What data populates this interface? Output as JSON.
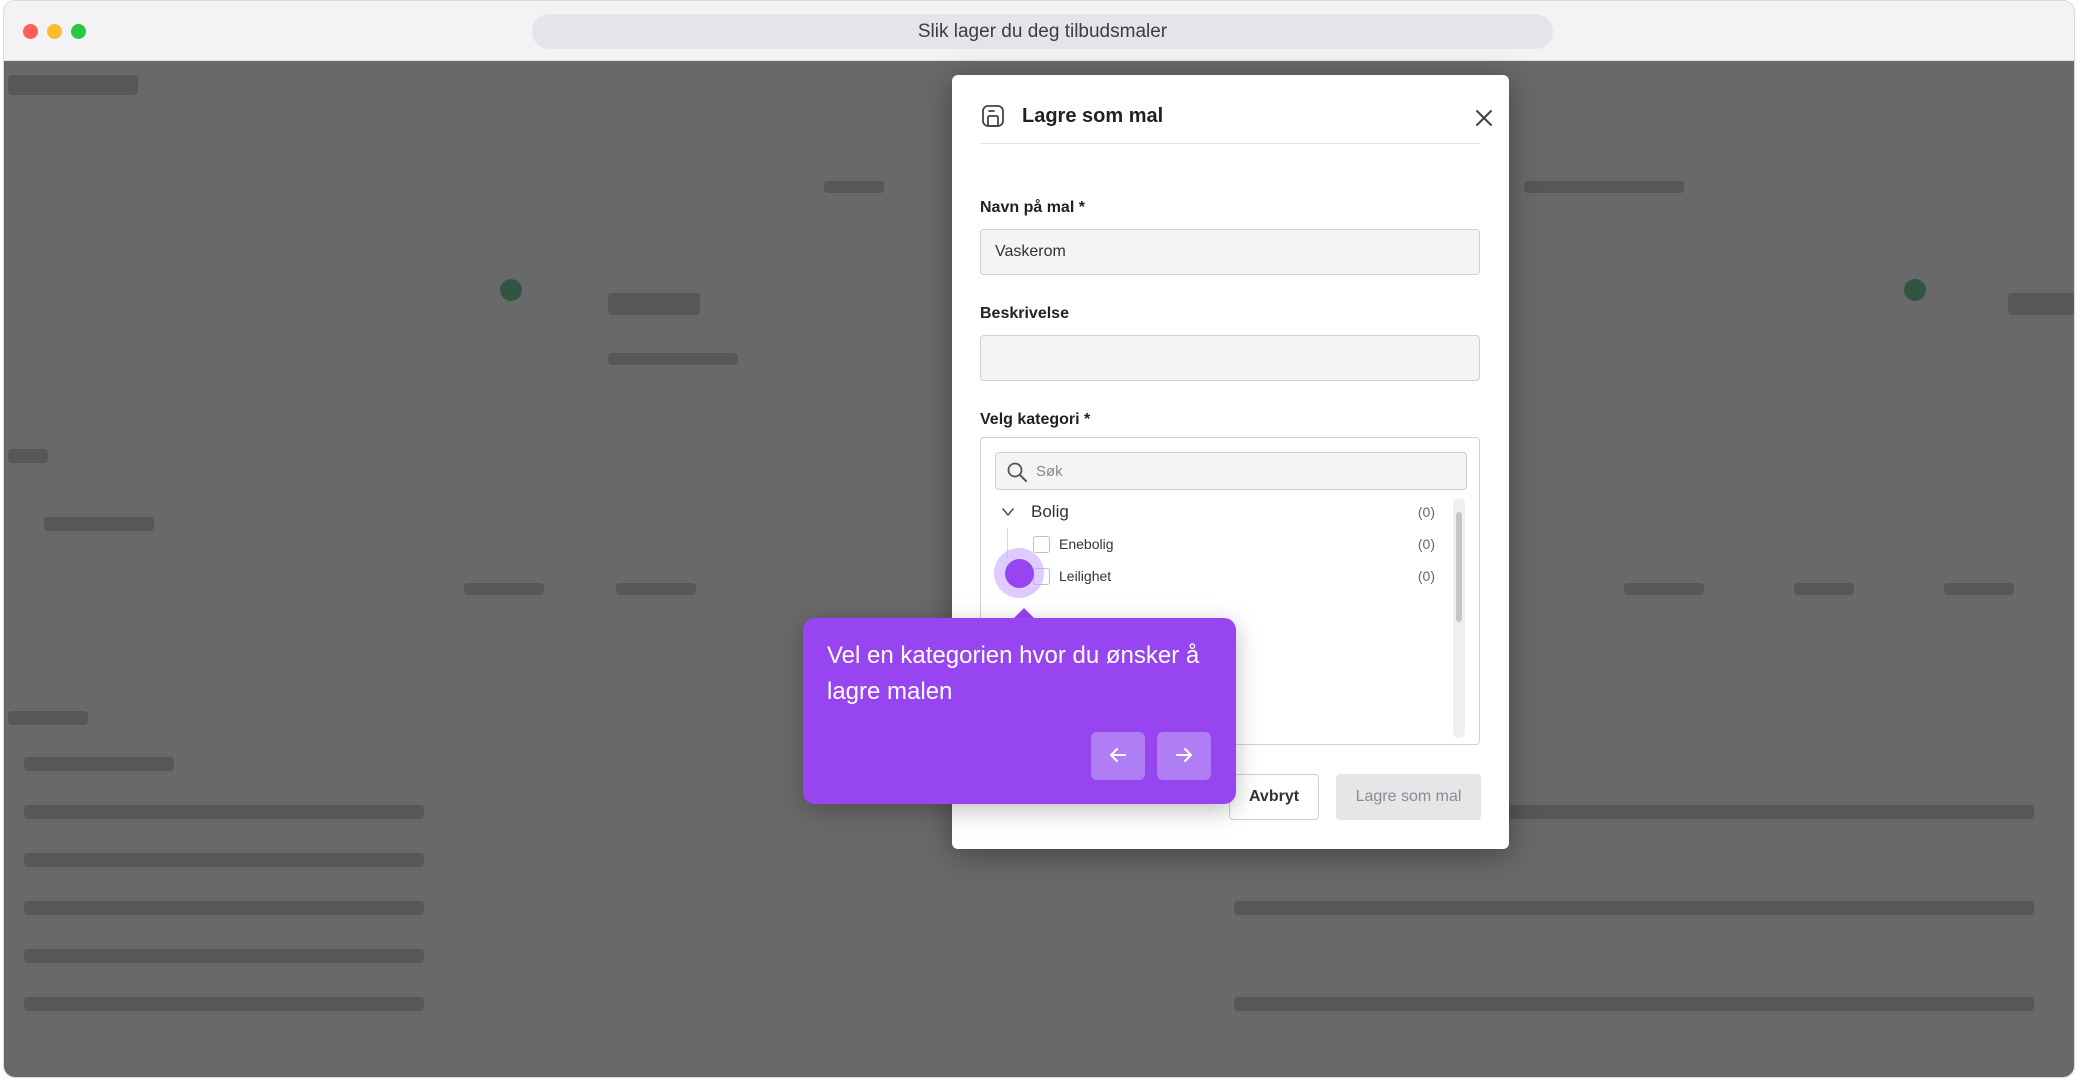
{
  "browser": {
    "address_text": "Slik lager du deg tilbudsmaler"
  },
  "modal": {
    "title": "Lagre som mal",
    "name_label": "Navn på mal *",
    "name_value": "Vaskerom",
    "description_label": "Beskrivelse",
    "description_value": "",
    "category_label": "Velg kategori *",
    "search_placeholder": "Søk",
    "category_tree": {
      "group": {
        "label": "Bolig",
        "count": "(0)"
      },
      "children": [
        {
          "label": "Enebolig",
          "count": "(0)"
        },
        {
          "label": "Leilighet",
          "count": "(0)"
        }
      ]
    },
    "cancel_label": "Avbryt",
    "save_label": "Lagre som mal"
  },
  "tour": {
    "text": "Vel en kategorien hvor du ønsker å lagre malen"
  },
  "colors": {
    "accent": "#9745f0",
    "accent_light": "#b07ef4"
  }
}
